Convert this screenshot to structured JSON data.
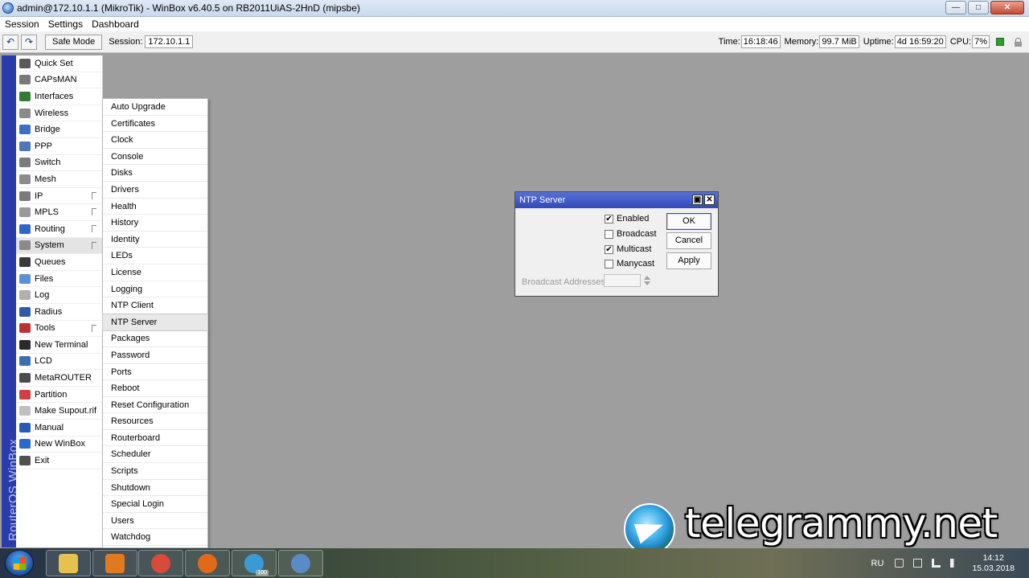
{
  "window": {
    "title": "admin@172.10.1.1 (MikroTik) - WinBox v6.40.5 on RB2011UiAS-2HnD (mipsbe)",
    "minimize": "—",
    "maximize": "□",
    "close": "✕"
  },
  "menubar": [
    "Session",
    "Settings",
    "Dashboard"
  ],
  "toolbar": {
    "undo_icon": "↶",
    "redo_icon": "↷",
    "safe_mode": "Safe Mode",
    "session_label": "Session:",
    "session_value": "172.10.1.1"
  },
  "status": {
    "time_label": "Time:",
    "time_value": "16:18:46",
    "memory_label": "Memory:",
    "memory_value": "99.7 MiB",
    "uptime_label": "Uptime:",
    "uptime_value": "4d 16:59:20",
    "cpu_label": "CPU:",
    "cpu_value": "7%"
  },
  "brand": "RouterOS WinBox",
  "main_menu": [
    {
      "label": "Quick Set",
      "icon": "quick-set-icon",
      "color": "#5a5a5a"
    },
    {
      "label": "CAPsMAN",
      "icon": "capsman-icon",
      "color": "#7a7a7a"
    },
    {
      "label": "Interfaces",
      "icon": "interfaces-icon",
      "color": "#2f7d32"
    },
    {
      "label": "Wireless",
      "icon": "wireless-icon",
      "color": "#8a8a8a"
    },
    {
      "label": "Bridge",
      "icon": "bridge-icon",
      "color": "#3a6fc4"
    },
    {
      "label": "PPP",
      "icon": "ppp-icon",
      "color": "#4a78b8"
    },
    {
      "label": "Switch",
      "icon": "switch-icon",
      "color": "#7c7c7c"
    },
    {
      "label": "Mesh",
      "icon": "mesh-icon",
      "color": "#8c8c8c"
    },
    {
      "label": "IP",
      "icon": "ip-icon",
      "color": "#7a7a7a",
      "submenu": true
    },
    {
      "label": "MPLS",
      "icon": "mpls-icon",
      "color": "#9a9a9a",
      "submenu": true
    },
    {
      "label": "Routing",
      "icon": "routing-icon",
      "color": "#2f66c4",
      "submenu": true
    },
    {
      "label": "System",
      "icon": "system-icon",
      "color": "#8a8a8a",
      "submenu": true,
      "active": true
    },
    {
      "label": "Queues",
      "icon": "queues-icon",
      "color": "#3a3a3a"
    },
    {
      "label": "Files",
      "icon": "files-icon",
      "color": "#5b8fd6"
    },
    {
      "label": "Log",
      "icon": "log-icon",
      "color": "#b0b0b0"
    },
    {
      "label": "Radius",
      "icon": "radius-icon",
      "color": "#2f5aa8"
    },
    {
      "label": "Tools",
      "icon": "tools-icon",
      "color": "#c03030",
      "submenu": true
    },
    {
      "label": "New Terminal",
      "icon": "terminal-icon",
      "color": "#2a2a2a"
    },
    {
      "label": "LCD",
      "icon": "lcd-icon",
      "color": "#3a6fb0"
    },
    {
      "label": "MetaROUTER",
      "icon": "metarouter-icon",
      "color": "#4c4c4c"
    },
    {
      "label": "Partition",
      "icon": "partition-icon",
      "color": "#d04040"
    },
    {
      "label": "Make Supout.rif",
      "icon": "supout-icon",
      "color": "#c0c0c0"
    },
    {
      "label": "Manual",
      "icon": "manual-icon",
      "color": "#2a5ab8"
    },
    {
      "label": "New WinBox",
      "icon": "winbox-icon",
      "color": "#2a6ac8"
    },
    {
      "label": "Exit",
      "icon": "exit-icon",
      "color": "#505050"
    }
  ],
  "system_submenu": [
    "Auto Upgrade",
    "Certificates",
    "Clock",
    "Console",
    "Disks",
    "Drivers",
    "Health",
    "History",
    "Identity",
    "LEDs",
    "License",
    "Logging",
    "NTP Client",
    "NTP Server",
    "Packages",
    "Password",
    "Ports",
    "Reboot",
    "Reset Configuration",
    "Resources",
    "Routerboard",
    "Scheduler",
    "Scripts",
    "Shutdown",
    "Special Login",
    "Users",
    "Watchdog"
  ],
  "submenu_selected": "NTP Server",
  "dialog": {
    "title": "NTP Server",
    "restore_icon": "▣",
    "close_icon": "✕",
    "checkboxes": [
      {
        "label": "Enabled",
        "checked": true
      },
      {
        "label": "Broadcast",
        "checked": false
      },
      {
        "label": "Multicast",
        "checked": true
      },
      {
        "label": "Manycast",
        "checked": false
      }
    ],
    "ok": "OK",
    "cancel": "Cancel",
    "apply": "Apply",
    "broadcast_addresses_label": "Broadcast Addresses:",
    "broadcast_addresses_value": ""
  },
  "taskbar": {
    "apps": [
      {
        "name": "explorer-icon",
        "color": "#e8c050"
      },
      {
        "name": "media-player-icon",
        "color": "#e07a20"
      },
      {
        "name": "chrome-icon",
        "color": "#d84a3a"
      },
      {
        "name": "firefox-icon",
        "color": "#e06a1a"
      },
      {
        "name": "telegram-icon",
        "color": "#3a9ad8",
        "badge": "100"
      },
      {
        "name": "winbox-taskbar-icon",
        "color": "#5a8ac8"
      }
    ],
    "language": "RU",
    "time": "14:12",
    "date": "15.03.2018"
  },
  "watermark": "telegrammy.net"
}
